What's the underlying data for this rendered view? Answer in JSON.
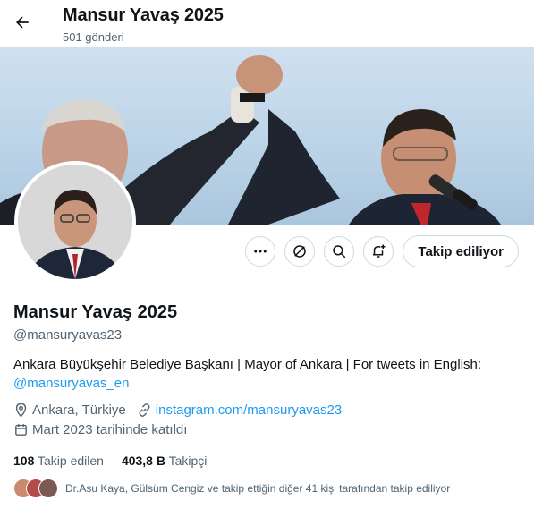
{
  "header": {
    "title": "Mansur Yavaş 2025",
    "post_count": "501 gönderi"
  },
  "profile": {
    "name": "Mansur Yavaş 2025",
    "handle": "@mansuryavas23",
    "bio_text": "Ankara Büyükşehir Belediye Başkanı | Mayor of Ankara | For tweets in English:",
    "bio_link": "@mansuryavas_en",
    "location": "Ankara, Türkiye",
    "website": "instagram.com/mansuryavas23",
    "joined": "Mart 2023 tarihinde katıldı",
    "following_count": "108",
    "following_label": "Takip edilen",
    "followers_count": "403,8 B",
    "followers_label": "Takipçi",
    "followed_by_text": "Dr.Asu Kaya, Gülsüm Cengiz ve takip ettiğin diğer 41 kişi tarafından takip ediliyor"
  },
  "actions": {
    "follow_label": "Takip ediliyor"
  },
  "icons": {
    "back": "arrow-left-icon",
    "more": "more-icon",
    "grok": "grok-icon",
    "search": "search-icon",
    "notify": "bell-plus-icon",
    "location": "location-pin-icon",
    "website": "link-icon",
    "joined": "calendar-icon"
  },
  "colors": {
    "accent": "#1d9bf0",
    "text": "#0f1419",
    "muted": "#536471"
  }
}
